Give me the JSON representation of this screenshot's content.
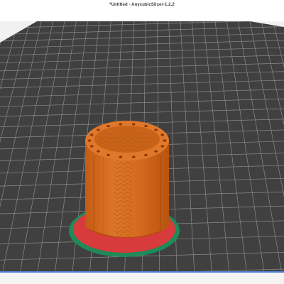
{
  "window": {
    "title": "*Untitled - AnycubicSlicer-1.2.2"
  },
  "viewport": {
    "bed_color": "#404040",
    "grid_color": "#8a8a8a",
    "model_color": "#d96a1f",
    "brim_red": "#d73b3b",
    "brim_green": "#1f8a5a"
  },
  "status": {
    "accent_line_color": "#4f7fd6"
  }
}
